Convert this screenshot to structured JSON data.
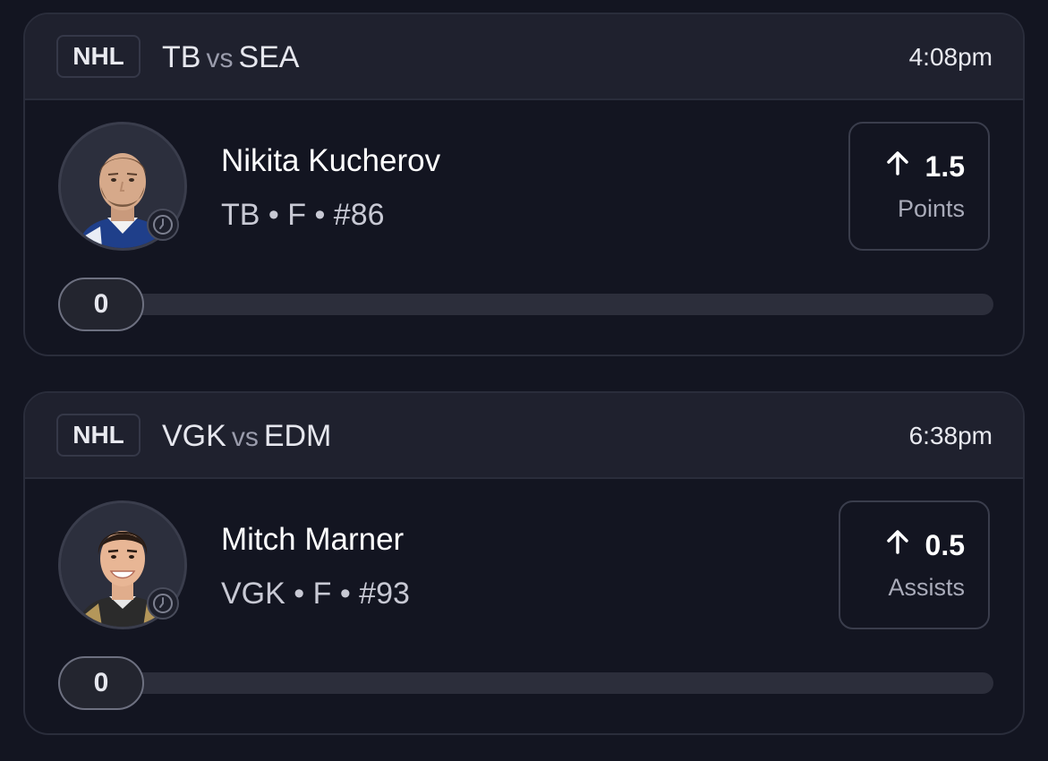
{
  "cards": [
    {
      "league": "NHL",
      "team_a": "TB",
      "vs": "vs",
      "team_b": "SEA",
      "time": "4:08pm",
      "player": {
        "name": "Nikita Kucherov",
        "team": "TB",
        "position": "F",
        "number": "#86",
        "meta": "TB • F • #86"
      },
      "line": {
        "direction_icon": "arrow-up-icon",
        "value": "1.5",
        "stat": "Points"
      },
      "progress": {
        "current": "0",
        "fraction": 0
      }
    },
    {
      "league": "NHL",
      "team_a": "VGK",
      "vs": "vs",
      "team_b": "EDM",
      "time": "6:38pm",
      "player": {
        "name": "Mitch Marner",
        "team": "VGK",
        "position": "F",
        "number": "#93",
        "meta": "VGK • F • #93"
      },
      "line": {
        "direction_icon": "arrow-up-icon",
        "value": "0.5",
        "stat": "Assists"
      },
      "progress": {
        "current": "0",
        "fraction": 0
      }
    }
  ],
  "colors": {
    "background": "#131521",
    "header": "#1f212e",
    "border": "#2a2d3b",
    "track": "#2c2e3b",
    "muted_text": "#a9abb9"
  }
}
